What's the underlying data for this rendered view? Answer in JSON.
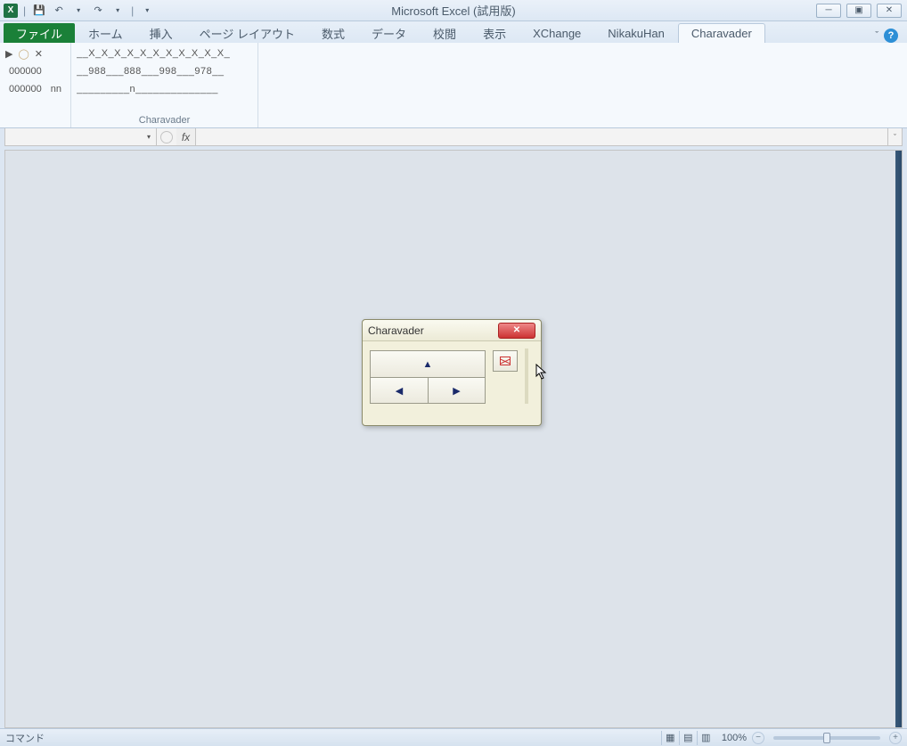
{
  "window": {
    "title": "Microsoft Excel (試用版)"
  },
  "qat": {
    "save": "💾",
    "undo": "↶",
    "redo": "↷",
    "sep": "|",
    "dd": "▾"
  },
  "win_controls": {
    "min": "─",
    "max": "▣",
    "close": "✕"
  },
  "tabs": {
    "file": "ファイル",
    "items": [
      "ホーム",
      "挿入",
      "ページ レイアウト",
      "数式",
      "データ",
      "校閲",
      "表示",
      "XChange",
      "NikakuHan",
      "Charavader"
    ],
    "active_index": 9,
    "minimize_hint": "ˇ"
  },
  "ribbon": {
    "group1": {
      "row1": {
        "a": "▶",
        "b": "◯",
        "c": "✕"
      },
      "row2": "000000",
      "row3_left": "000000",
      "row3_right": "nn"
    },
    "group2": {
      "line1": "__X_X_X_X_X_X_X_X_X_X_X_",
      "line2": "__988___888___998___978__",
      "line3": "_________n______________",
      "title": "Charavader"
    }
  },
  "formula_bar": {
    "name": "",
    "fx": "fx",
    "dd": "▾",
    "expand": "ˇ"
  },
  "dialog": {
    "title": "Charavader",
    "close": "✕",
    "up": "▲",
    "left": "◀",
    "right": "▶"
  },
  "statusbar": {
    "mode": "コマンド",
    "zoom": "100%",
    "minus": "−",
    "plus": "+",
    "views": {
      "normal": "▦",
      "layout": "▤",
      "break": "▥"
    }
  }
}
